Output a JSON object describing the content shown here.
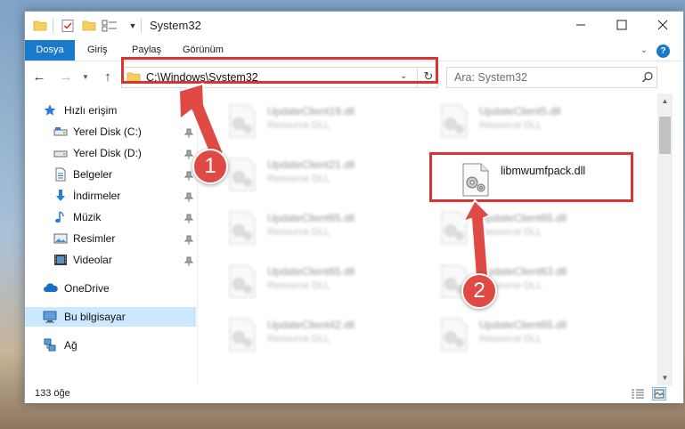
{
  "window": {
    "title": "System32",
    "quick_access_toolbar": [
      "folder-icon",
      "properties-icon",
      "new-folder-icon",
      "view-options-icon",
      "chevron-down-icon"
    ]
  },
  "ribbon": {
    "tabs": [
      "Dosya",
      "Giriş",
      "Paylaş",
      "Görünüm"
    ],
    "active_tab": "Dosya",
    "accent_color": "#1979ca"
  },
  "address_bar": {
    "path": "C:\\Windows\\System32"
  },
  "search": {
    "placeholder": "Ara: System32"
  },
  "sidebar": {
    "items": [
      {
        "label": "Hızlı erişim",
        "icon": "star-icon"
      },
      {
        "label": "Yerel Disk (C:)",
        "icon": "drive-icon",
        "pinned": true
      },
      {
        "label": "Yerel Disk (D:)",
        "icon": "drive-icon",
        "pinned": true
      },
      {
        "label": "Belgeler",
        "icon": "documents-icon",
        "pinned": true
      },
      {
        "label": "İndirmeler",
        "icon": "download-icon",
        "pinned": true
      },
      {
        "label": "Müzik",
        "icon": "music-icon",
        "pinned": true
      },
      {
        "label": "Resimler",
        "icon": "pictures-icon",
        "pinned": true
      },
      {
        "label": "Videolar",
        "icon": "video-icon",
        "pinned": true
      },
      {
        "label": "OneDrive",
        "icon": "cloud-icon"
      },
      {
        "label": "Bu bilgisayar",
        "icon": "computer-icon",
        "selected": true
      },
      {
        "label": "Ağ",
        "icon": "network-icon"
      }
    ]
  },
  "files": {
    "left_column": [
      {
        "name": "UpdateClient19.dll",
        "type": "Resource DLL"
      },
      {
        "name": "UpdateClient21.dll",
        "type": "Resource DLL"
      },
      {
        "name": "UpdateClient65.dll",
        "type": "Resource DLL"
      },
      {
        "name": "UpdateClient65.dll",
        "type": "Resource DLL"
      },
      {
        "name": "UpdateClient42.dll",
        "type": "Resource DLL"
      }
    ],
    "right_column": [
      {
        "name": "UpdateClient5.dll",
        "type": "Resource DLL"
      },
      {
        "name": "UpdateClient65.dll",
        "type": "Resource DLL"
      },
      {
        "name": "UpdateClient63.dll",
        "type": "Resource DLL"
      },
      {
        "name": "UpdateClient65.dll",
        "type": "Resource DLL"
      }
    ],
    "target": {
      "name": "libmwumfpack.dll"
    }
  },
  "status_bar": {
    "item_count": "133 öğe"
  },
  "annotations": {
    "step1": "1",
    "step2": "2",
    "color": "#d9342f"
  }
}
